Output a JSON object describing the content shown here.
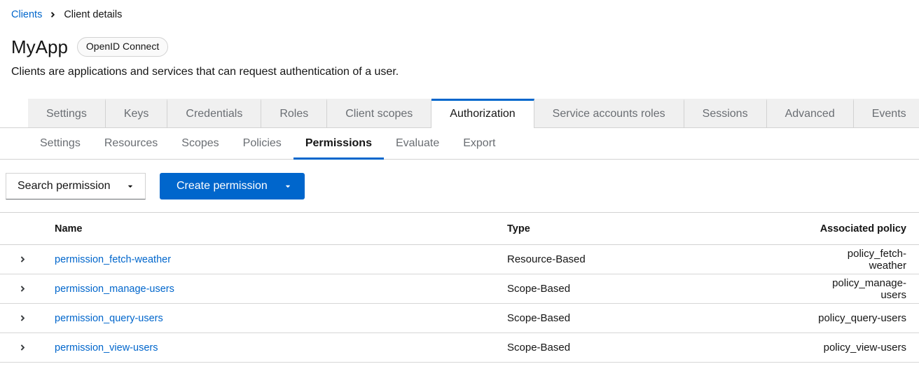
{
  "breadcrumb": {
    "items": [
      "Clients",
      "Client details"
    ]
  },
  "header": {
    "title": "MyApp",
    "badge": "OpenID Connect",
    "description": "Clients are applications and services that can request authentication of a user."
  },
  "tabs": {
    "active": "Authorization",
    "items": [
      "Settings",
      "Keys",
      "Credentials",
      "Roles",
      "Client scopes",
      "Authorization",
      "Service accounts roles",
      "Sessions",
      "Advanced",
      "Events"
    ]
  },
  "subtabs": {
    "active": "Permissions",
    "items": [
      "Settings",
      "Resources",
      "Scopes",
      "Policies",
      "Permissions",
      "Evaluate",
      "Export"
    ]
  },
  "toolbar": {
    "search_dropdown_label": "Search permission",
    "create_button_label": "Create permission"
  },
  "table": {
    "columns": {
      "name": "Name",
      "type": "Type",
      "policy": "Associated policy"
    },
    "rows": [
      {
        "name": "permission_fetch-weather",
        "type": "Resource-Based",
        "policy": "policy_fetch-weather"
      },
      {
        "name": "permission_manage-users",
        "type": "Scope-Based",
        "policy": "policy_manage-users"
      },
      {
        "name": "permission_query-users",
        "type": "Scope-Based",
        "policy": "policy_query-users"
      },
      {
        "name": "permission_view-users",
        "type": "Scope-Based",
        "policy": "policy_view-users"
      }
    ]
  },
  "icons": {
    "breadcrumb_divider": "angle-right",
    "row_expand": "angle-right",
    "dropdown_caret": "caret-down"
  },
  "colors": {
    "accent_blue": "#0066cc",
    "link_blue": "#0066cc",
    "tab_inactive_bg": "#f0f0f0",
    "text_primary": "#151515",
    "text_muted": "#6a6e73",
    "border": "#d2d2d2"
  }
}
